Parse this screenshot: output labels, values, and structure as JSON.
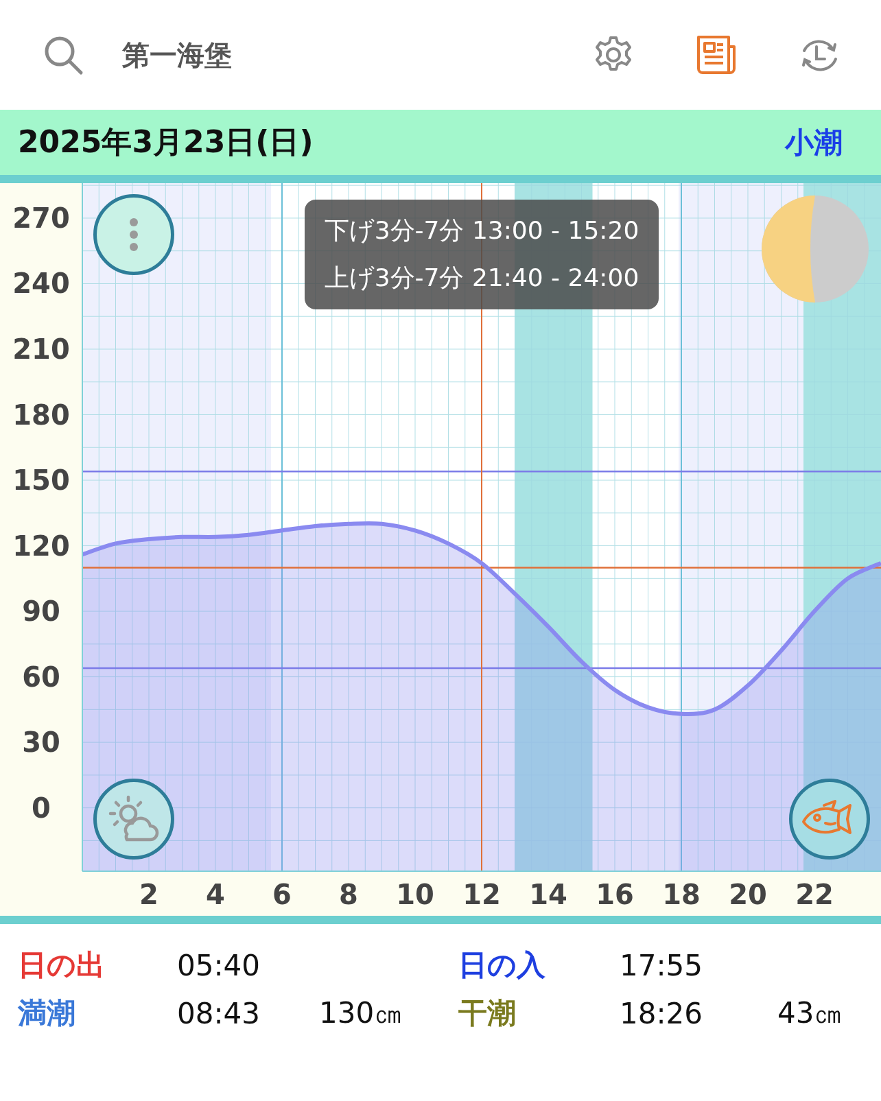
{
  "header": {
    "title": "第一海堡",
    "toolbar": [
      {
        "kind": "settings",
        "selected": false
      },
      {
        "kind": "news",
        "selected": true
      },
      {
        "kind": "history",
        "selected": false
      }
    ]
  },
  "date_bar": {
    "date": "2025年3月23日(日)",
    "tide_name": "小潮"
  },
  "chart": {
    "tooltip": [
      "下げ3分-7分 13:00 - 15:20",
      "上げ3分-7分 21:40 - 24:00"
    ],
    "chart_data": {
      "type": "area",
      "x": [
        0,
        1,
        2,
        3,
        4,
        5,
        6,
        7,
        8,
        9,
        10,
        11,
        12,
        13,
        14,
        15,
        16,
        17,
        18,
        19,
        20,
        21,
        22,
        23,
        24
      ],
      "series": [
        {
          "color": "#8a8af0",
          "values": [
            116,
            121,
            123,
            124,
            124,
            125,
            127,
            129,
            130,
            130,
            127,
            121,
            112,
            98,
            83,
            67,
            54,
            46,
            43,
            45,
            56,
            72,
            90,
            105,
            112
          ]
        }
      ],
      "xlim": [
        0,
        24
      ],
      "ylim": [
        -29,
        286
      ],
      "xticks": [
        2,
        4,
        6,
        8,
        10,
        12,
        14,
        16,
        18,
        20,
        22
      ],
      "yticks": [
        0,
        30,
        60,
        90,
        120,
        150,
        180,
        210,
        240,
        270
      ],
      "grid": true,
      "bands": [
        {
          "axis": "x",
          "from": 0,
          "to": 5.67,
          "color": "#eef0fd"
        },
        {
          "axis": "x",
          "from": 17.92,
          "to": 24,
          "color": "#eef0fd"
        },
        {
          "axis": "x",
          "from": 13,
          "to": 15.33,
          "color": "#a8e3e3"
        },
        {
          "axis": "x",
          "from": 21.67,
          "to": 24,
          "color": "#a8e3e3"
        }
      ],
      "ref_lines": [
        {
          "axis": "y",
          "value": 154,
          "color": "#7b7be8"
        },
        {
          "axis": "y",
          "value": 110,
          "color": "#e0703a"
        },
        {
          "axis": "y",
          "value": 64,
          "color": "#7b7be8"
        },
        {
          "axis": "x",
          "value": 12,
          "color": "#e0703a"
        }
      ]
    }
  },
  "info": [
    [
      {
        "label": "日の出",
        "color": "#e53935",
        "time": "05:40"
      },
      {
        "label": "日の入",
        "color": "#1e3fe0",
        "time": "17:55"
      }
    ],
    [
      {
        "label": "満潮",
        "color": "#3a78d8",
        "time": "08:43",
        "height": "130㎝"
      },
      {
        "label": "干潮",
        "color": "#7a7a1e",
        "time": "18:26",
        "height": "43㎝"
      }
    ]
  ]
}
